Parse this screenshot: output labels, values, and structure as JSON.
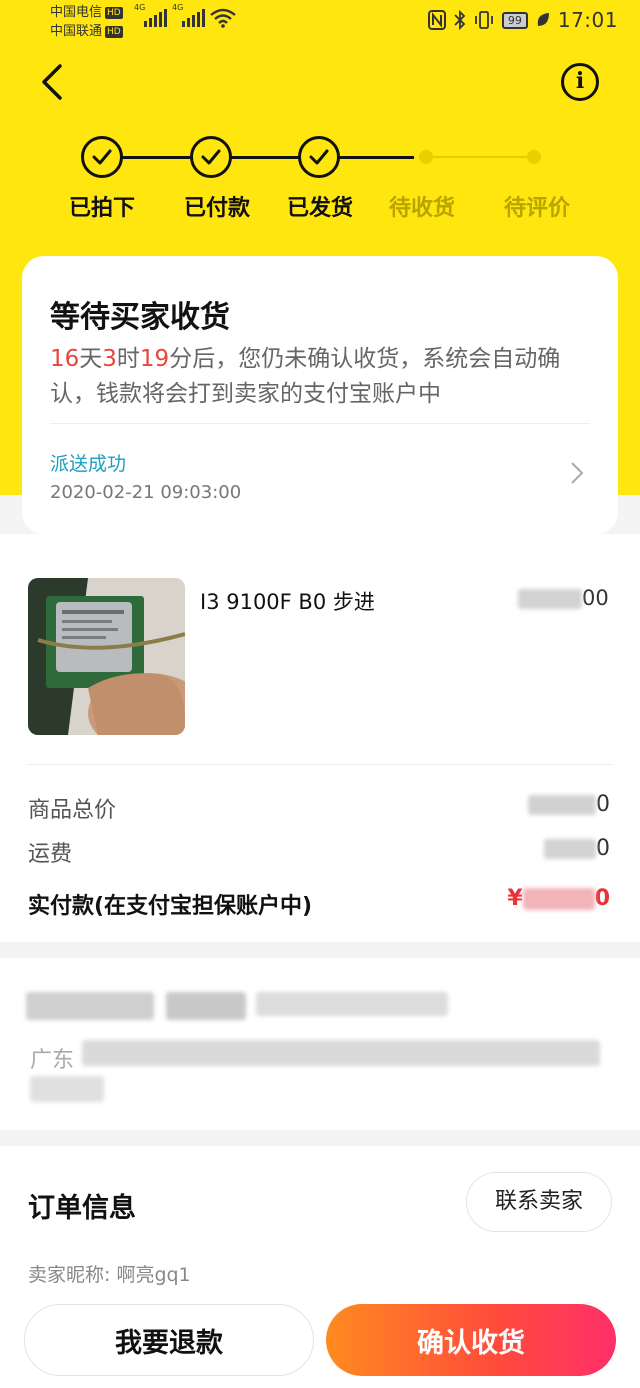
{
  "status_bar": {
    "carrier1": "中国电信",
    "carrier2": "中国联通",
    "hd": "HD",
    "net1": "4G",
    "net2": "4G",
    "battery": "99",
    "time": "17:01"
  },
  "header": {
    "back_icon": "chevron-left-icon",
    "info_icon": "info-icon",
    "info_glyph": "i"
  },
  "progress": {
    "steps": [
      {
        "label": "已拍下",
        "done": true
      },
      {
        "label": "已付款",
        "done": true
      },
      {
        "label": "已发货",
        "done": true
      },
      {
        "label": "待收货",
        "done": false
      },
      {
        "label": "待评价",
        "done": false
      }
    ]
  },
  "status_card": {
    "title": "等待买家收货",
    "days": "16",
    "days_unit": "天",
    "hours": "3",
    "hours_unit": "时",
    "minutes": "19",
    "desc_rest": "分后，您仍未确认收货，系统会自动确认，钱款将会打到卖家的支付宝账户中",
    "delivery_status": "派送成功",
    "delivery_time": "2020-02-21 09:03:00"
  },
  "product": {
    "title": "I3 9100F B0 步进",
    "price_visible": "00"
  },
  "price_summary": {
    "goods_total_label": "商品总价",
    "goods_total_visible": "0",
    "shipping_label": "运费",
    "shipping_visible": "0",
    "paid_label": "实付款(在支付宝担保账户中)",
    "paid_prefix": "¥",
    "paid_visible": "0"
  },
  "address": {
    "province_visible": "广东"
  },
  "order_info": {
    "title": "订单信息",
    "contact_seller": "联系卖家",
    "seller_nickname": "卖家昵称: 啊亮gq1"
  },
  "actions": {
    "refund": "我要退款",
    "confirm": "确认收货"
  },
  "colors": {
    "brand_yellow": "#ffe60f",
    "accent_red": "#e8453c",
    "link_blue": "#1ba0c4"
  }
}
